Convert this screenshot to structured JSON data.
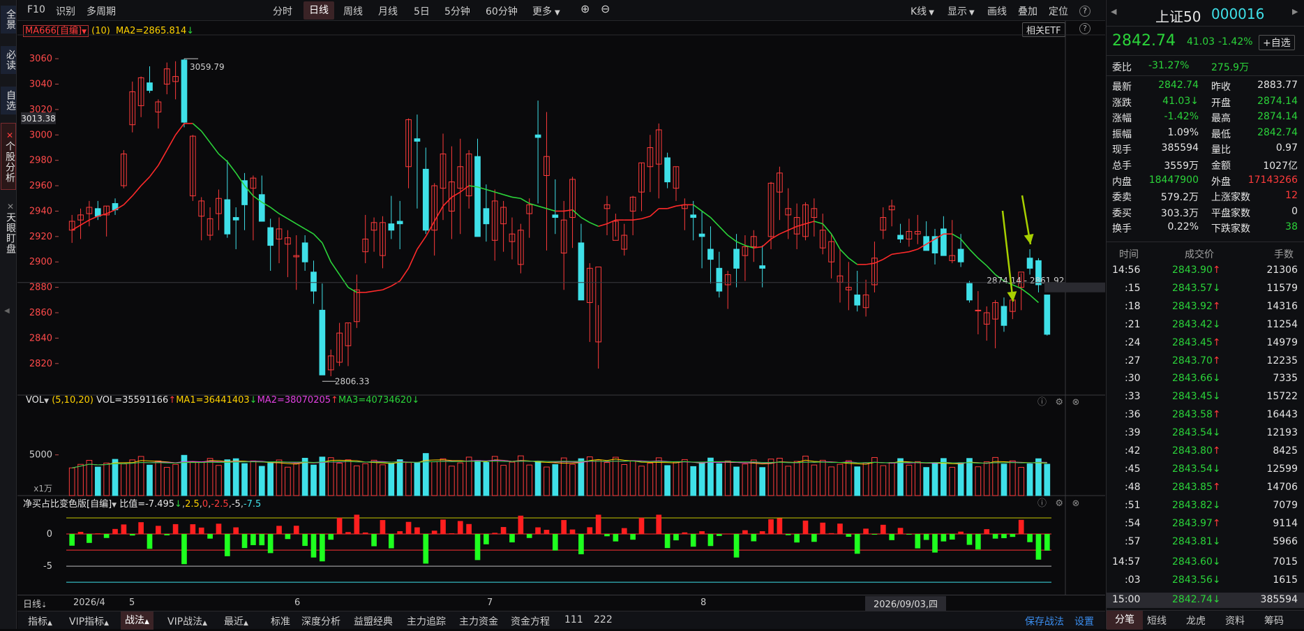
{
  "leftbar": {
    "items": [
      "全景",
      "必读",
      "自选",
      "个股分析",
      "天眼盯盘"
    ]
  },
  "topbar": {
    "left": [
      "F10",
      "识别",
      "多周期"
    ],
    "periods": [
      "分时",
      "日线",
      "周线",
      "月线",
      "5日",
      "5分钟",
      "60分钟",
      "更多"
    ],
    "active_period": "日线",
    "zoom_in": "⊕",
    "zoom_out": "⊖",
    "right": [
      "K线",
      "显示",
      "画线",
      "叠加",
      "定位"
    ],
    "help": "?"
  },
  "kpanel": {
    "indicator": "MA666[自编]",
    "param": "(10)",
    "ma2_label": "MA2=2865.814",
    "etf_button": "相关ETF",
    "cursor_price": "3013.38",
    "high_label": "3059.79",
    "low_label": "2806.33",
    "range_label": "2874.14 - 2861.92",
    "yticks": [
      "3060",
      "3040",
      "3020",
      "3000",
      "2980",
      "2960",
      "2940",
      "2920",
      "2900",
      "2880",
      "2860",
      "2840",
      "2820"
    ]
  },
  "volpanel": {
    "name": "VOL",
    "params": "(5,10,20)",
    "vol": "VOL=35591166",
    "ma1": "MA1=36441403",
    "ma2": "MA2=38070205",
    "ma3": "MA3=40734620",
    "ytick": "5000",
    "unit": "x1万"
  },
  "netpanel": {
    "name": "净买占比变色版[自编]",
    "v1": "比值=-7.495",
    "v2": "2.5",
    "v3": "0",
    "v4": "-2.5",
    "v5": "-5",
    "v6": "-7.5",
    "yticks": [
      "0",
      "-5"
    ]
  },
  "xaxis": {
    "period": "日线",
    "labels": [
      "2026/4",
      "5",
      "6",
      "7",
      "8"
    ],
    "cursor_date": "2026/09/03,四"
  },
  "stock": {
    "name": "上证50",
    "code": "000016",
    "price": "2842.74",
    "change": "41.03",
    "pct": "-1.42%",
    "watch_btn": "+自选",
    "wb_label": "委比",
    "wb_value": "-31.27%",
    "wc_value": "275.9万"
  },
  "quote": [
    {
      "l": "最新",
      "v": "2842.74",
      "vc": "green",
      "l2": "昨收",
      "v2": "2883.77",
      "v2c": "white"
    },
    {
      "l": "涨跌",
      "v": "41.03",
      "vc": "green",
      "l2": "开盘",
      "v2": "2874.14",
      "v2c": "green"
    },
    {
      "l": "涨幅",
      "v": "-1.42%",
      "vc": "green",
      "l2": "最高",
      "v2": "2874.14",
      "v2c": "green"
    },
    {
      "l": "振幅",
      "v": "1.09%",
      "vc": "white",
      "l2": "最低",
      "v2": "2842.74",
      "v2c": "green"
    },
    {
      "l": "现手",
      "v": "385594",
      "vc": "white",
      "l2": "量比",
      "v2": "0.97",
      "v2c": "white"
    },
    {
      "l": "总手",
      "v": "3559万",
      "vc": "white",
      "l2": "金额",
      "v2": "1027亿",
      "v2c": "white"
    },
    {
      "l": "内盘",
      "v": "18447900",
      "vc": "green",
      "l2": "外盘",
      "v2": "17143266",
      "v2c": "red"
    },
    {
      "l": "委卖",
      "v": "579.2万",
      "vc": "white",
      "l2": "上涨家数",
      "v2": "12",
      "v2c": "red"
    },
    {
      "l": "委买",
      "v": "303.3万",
      "vc": "white",
      "l2": "平盘家数",
      "v2": "0",
      "v2c": "white"
    },
    {
      "l": "换手",
      "v": "0.22%",
      "vc": "white",
      "l2": "下跌家数",
      "v2": "38",
      "v2c": "green"
    }
  ],
  "ticks_header": {
    "time": "时间",
    "price": "成交价",
    "vol": "手数"
  },
  "ticks": [
    {
      "t": "14:56",
      "p": "2843.90",
      "d": "up",
      "v": "21306"
    },
    {
      "t": ":15",
      "p": "2843.57",
      "d": "down",
      "v": "11579"
    },
    {
      "t": ":18",
      "p": "2843.92",
      "d": "up",
      "v": "14316"
    },
    {
      "t": ":21",
      "p": "2843.42",
      "d": "down",
      "v": "11254"
    },
    {
      "t": ":24",
      "p": "2843.45",
      "d": "up",
      "v": "14979"
    },
    {
      "t": ":27",
      "p": "2843.70",
      "d": "up",
      "v": "12235"
    },
    {
      "t": ":30",
      "p": "2843.66",
      "d": "down",
      "v": "7335"
    },
    {
      "t": ":33",
      "p": "2843.45",
      "d": "down",
      "v": "15722"
    },
    {
      "t": ":36",
      "p": "2843.58",
      "d": "up",
      "v": "16443"
    },
    {
      "t": ":39",
      "p": "2843.54",
      "d": "down",
      "v": "12193"
    },
    {
      "t": ":42",
      "p": "2843.80",
      "d": "up",
      "v": "8425"
    },
    {
      "t": ":45",
      "p": "2843.54",
      "d": "down",
      "v": "12599"
    },
    {
      "t": ":48",
      "p": "2843.85",
      "d": "up",
      "v": "14706"
    },
    {
      "t": ":51",
      "p": "2843.82",
      "d": "down",
      "v": "7079"
    },
    {
      "t": ":54",
      "p": "2843.97",
      "d": "up",
      "v": "9114"
    },
    {
      "t": ":57",
      "p": "2843.81",
      "d": "down",
      "v": "5966"
    },
    {
      "t": "14:57",
      "p": "2843.60",
      "d": "down",
      "v": "7015"
    },
    {
      "t": ":03",
      "p": "2843.56",
      "d": "down",
      "v": "1615"
    },
    {
      "t": "15:00",
      "p": "2842.74",
      "d": "down",
      "v": "385594"
    }
  ],
  "right_tabs": [
    "分笔",
    "短线",
    "龙虎",
    "资料",
    "筹码"
  ],
  "bottombar": {
    "tabs": [
      "指标",
      "VIP指标",
      "战法",
      "VIP战法",
      "最近"
    ],
    "links": [
      "标准",
      "深度分析",
      "益盟经典",
      "主力追踪",
      "主力资金",
      "资金方程",
      "111",
      "222"
    ],
    "save": "保存战法",
    "settings": "设置"
  },
  "colors": {
    "up": "#ff3b3b",
    "down": "#3fe0e8",
    "ma": "#2bd43a",
    "bg": "#0a0a0c",
    "arrow": "#a8d000"
  },
  "chart_data": {
    "type": "candlestick",
    "ohlc": [
      [
        2925,
        2937,
        2915,
        2932
      ],
      [
        2933,
        2942,
        2918,
        2937
      ],
      [
        2938,
        2948,
        2928,
        2943
      ],
      [
        2942,
        2948,
        2933,
        2936
      ],
      [
        2937,
        2944,
        2920,
        2944
      ],
      [
        2946,
        2950,
        2937,
        2941
      ],
      [
        2960,
        2988,
        2958,
        2985
      ],
      [
        3008,
        3042,
        3002,
        3034
      ],
      [
        3023,
        3046,
        3014,
        3045
      ],
      [
        3041,
        3054,
        3033,
        3035
      ],
      [
        3018,
        3028,
        3005,
        3026
      ],
      [
        3040,
        3057,
        3032,
        3052
      ],
      [
        3042,
        3058,
        3028,
        3046
      ],
      [
        3059,
        3060,
        3006,
        3010
      ],
      [
        2952,
        3000,
        2948,
        2999
      ],
      [
        2936,
        2951,
        2917,
        2948
      ],
      [
        2921,
        2943,
        2917,
        2934
      ],
      [
        2938,
        2957,
        2925,
        2950
      ],
      [
        2949,
        2980,
        2919,
        2922
      ],
      [
        2935,
        2943,
        2910,
        2933
      ],
      [
        2964,
        2970,
        2925,
        2945
      ],
      [
        2958,
        2968,
        2917,
        2966
      ],
      [
        2953,
        2968,
        2950,
        2932
      ],
      [
        2927,
        2934,
        2893,
        2913
      ],
      [
        2918,
        2935,
        2899,
        2926
      ],
      [
        2914,
        2925,
        2888,
        2919
      ],
      [
        2904,
        2921,
        2878,
        2905
      ],
      [
        2915,
        2921,
        2893,
        2900
      ],
      [
        2892,
        2901,
        2867,
        2877
      ],
      [
        2862,
        2883,
        2852,
        2811
      ],
      [
        2815,
        2831,
        2810,
        2826
      ],
      [
        2821,
        2852,
        2818,
        2844
      ],
      [
        2834,
        2852,
        2818,
        2852
      ],
      [
        2853,
        2890,
        2848,
        2878
      ],
      [
        2908,
        2937,
        2899,
        2918
      ],
      [
        2925,
        2935,
        2908,
        2931
      ],
      [
        2905,
        2936,
        2895,
        2931
      ],
      [
        2930,
        2952,
        2918,
        2925
      ],
      [
        2932,
        2948,
        2910,
        2930
      ],
      [
        2975,
        3013,
        2958,
        3012
      ],
      [
        2997,
        3016,
        2942,
        2995
      ],
      [
        2973,
        2990,
        2922,
        2925
      ],
      [
        2925,
        2962,
        2905,
        2960
      ],
      [
        2958,
        3001,
        2933,
        2985
      ],
      [
        2940,
        2991,
        2918,
        2963
      ],
      [
        2958,
        2997,
        2922,
        2975
      ],
      [
        2952,
        2988,
        2942,
        2985
      ],
      [
        2983,
        2997,
        2925,
        2920
      ],
      [
        2942,
        2961,
        2916,
        2930
      ],
      [
        2917,
        2957,
        2901,
        2948
      ],
      [
        2930,
        2948,
        2908,
        2943
      ],
      [
        2916,
        2935,
        2902,
        2922
      ],
      [
        2898,
        2930,
        2891,
        2925
      ],
      [
        2938,
        2950,
        2919,
        2945
      ],
      [
        3000,
        3027,
        2946,
        2998
      ],
      [
        2968,
        3018,
        2909,
        2983
      ],
      [
        2937,
        2965,
        2922,
        2935
      ],
      [
        2907,
        2948,
        2878,
        2933
      ],
      [
        2935,
        2967,
        2911,
        2965
      ],
      [
        2915,
        2930,
        2880,
        2870
      ],
      [
        2868,
        2899,
        2837,
        2895
      ],
      [
        2837,
        2866,
        2816,
        2896
      ],
      [
        2942,
        2952,
        2921,
        2945
      ],
      [
        2917,
        2938,
        2920,
        2932
      ],
      [
        2910,
        2930,
        2905,
        2921
      ],
      [
        2940,
        2952,
        2921,
        2951
      ],
      [
        2955,
        2978,
        2940,
        2978
      ],
      [
        2975,
        3000,
        2955,
        2990
      ],
      [
        2977,
        3009,
        2950,
        3004
      ],
      [
        2982,
        2986,
        2958,
        2963
      ],
      [
        2958,
        2975,
        2948,
        2975
      ],
      [
        2942,
        2950,
        2925,
        2945
      ],
      [
        2937,
        2948,
        2917,
        2935
      ],
      [
        2922,
        2940,
        2895,
        2920
      ],
      [
        2910,
        2928,
        2883,
        2902
      ],
      [
        2895,
        2908,
        2872,
        2877
      ],
      [
        2882,
        2893,
        2863,
        2890
      ],
      [
        2910,
        2922,
        2880,
        2895
      ],
      [
        2905,
        2921,
        2885,
        2912
      ],
      [
        2912,
        2925,
        2900,
        2920
      ],
      [
        2897,
        2913,
        2880,
        2895
      ],
      [
        2920,
        2963,
        2910,
        2962
      ],
      [
        2955,
        2975,
        2933,
        2970
      ],
      [
        2937,
        2958,
        2918,
        2942
      ],
      [
        2922,
        2946,
        2910,
        2935
      ],
      [
        2920,
        2947,
        2917,
        2945
      ],
      [
        2935,
        2950,
        2920,
        2942
      ],
      [
        2911,
        2938,
        2906,
        2925
      ],
      [
        2900,
        2922,
        2887,
        2916
      ],
      [
        2884,
        2910,
        2868,
        2889
      ],
      [
        2878,
        2900,
        2862,
        2880
      ],
      [
        2874,
        2893,
        2861,
        2866
      ],
      [
        2864,
        2886,
        2857,
        2874
      ],
      [
        2882,
        2916,
        2876,
        2903
      ],
      [
        2925,
        2943,
        2918,
        2935
      ],
      [
        2941,
        2949,
        2928,
        2944
      ],
      [
        2921,
        2930,
        2915,
        2918
      ],
      [
        2918,
        2934,
        2912,
        2924
      ],
      [
        2922,
        2937,
        2914,
        2924
      ],
      [
        2920,
        2932,
        2910,
        2909
      ],
      [
        2920,
        2926,
        2898,
        2907
      ],
      [
        2926,
        2936,
        2905,
        2905
      ],
      [
        2901,
        2933,
        2899,
        2905
      ],
      [
        2910,
        2922,
        2896,
        2900
      ],
      [
        2883,
        2885,
        2868,
        2870
      ],
      [
        2862,
        2877,
        2843,
        2862
      ],
      [
        2851,
        2865,
        2838,
        2860
      ],
      [
        2855,
        2870,
        2832,
        2868
      ],
      [
        2865,
        2872,
        2845,
        2850
      ],
      [
        2861,
        2874,
        2855,
        2870
      ],
      [
        2880,
        2891,
        2862,
        2892
      ],
      [
        2903,
        2910,
        2890,
        2895
      ],
      [
        2901,
        2903,
        2876,
        2882
      ],
      [
        2874,
        2874,
        2842,
        2843
      ]
    ],
    "ma": [
      2925,
      2929,
      2933,
      2936,
      2938,
      2941,
      2945,
      2952,
      2960,
      2967,
      2976,
      2988,
      3000,
      3009,
      3009,
      3003,
      2994,
      2985,
      2979,
      2970,
      2960,
      2952,
      2947,
      2943,
      2938,
      2934,
      2930,
      2926,
      2922,
      2915,
      2900,
      2890,
      2880,
      2876,
      2876,
      2877,
      2878,
      2881,
      2885,
      2895,
      2910,
      2920,
      2932,
      2944,
      2951,
      2955,
      2960,
      2959,
      2957,
      2955,
      2953,
      2951,
      2950,
      2946,
      2944,
      2942,
      2940,
      2940,
      2941,
      2935,
      2931,
      2928,
      2930,
      2933,
      2933,
      2933,
      2934,
      2936,
      2942,
      2942,
      2944,
      2945,
      2945,
      2940,
      2935,
      2928,
      2921,
      2916,
      2913,
      2911,
      2912,
      2918,
      2922,
      2925,
      2928,
      2930,
      2932,
      2930,
      2922,
      2910,
      2903,
      2898,
      2898,
      2899,
      2902,
      2906,
      2907,
      2908,
      2910,
      2914,
      2918,
      2922,
      2922,
      2918,
      2910,
      2903,
      2897,
      2890,
      2885,
      2882,
      2879,
      2874,
      2868
    ],
    "yrange": [
      2810,
      3065
    ],
    "x_labels": [
      "2026/4",
      "5",
      "6",
      "7",
      "8"
    ]
  }
}
